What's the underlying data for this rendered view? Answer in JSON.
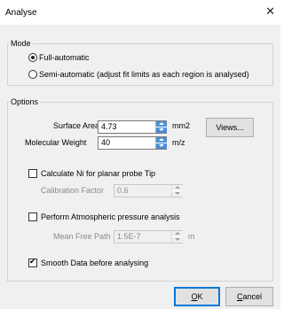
{
  "window": {
    "title": "Analyse",
    "close_glyph": "✕"
  },
  "mode": {
    "legend": "Mode",
    "options": [
      {
        "label": "Full-automatic",
        "selected": true
      },
      {
        "label": "Semi-automatic (adjust fit limits as each region is analysed)",
        "selected": false
      }
    ]
  },
  "options": {
    "legend": "Options",
    "surface_area": {
      "label": "Surface Area",
      "value": "4.73",
      "unit": "mm2"
    },
    "molecular_weight": {
      "label": "Molecular Weight",
      "value": "40",
      "unit": "m/z"
    },
    "views_button": "Views...",
    "calc_ni": {
      "label": "Calculate Ni for planar probe Tip",
      "checked": false
    },
    "calibration": {
      "label": "Calibration Factor",
      "value": "0.6"
    },
    "atmospheric": {
      "label": "Perform Atmospheric pressure analysis",
      "checked": false
    },
    "mean_free_path": {
      "label": "Mean Free Path",
      "value": "1.5E-7",
      "unit": "m"
    },
    "smooth": {
      "label": "Smooth Data before analysing",
      "checked": true,
      "checkmark": "✔"
    }
  },
  "footer": {
    "ok": {
      "mnemonic": "O",
      "rest": "K"
    },
    "cancel": {
      "mnemonic": "C",
      "rest": "ancel"
    }
  },
  "colors": {
    "accent": "#4a8fd6",
    "default_border": "#0078d7"
  }
}
